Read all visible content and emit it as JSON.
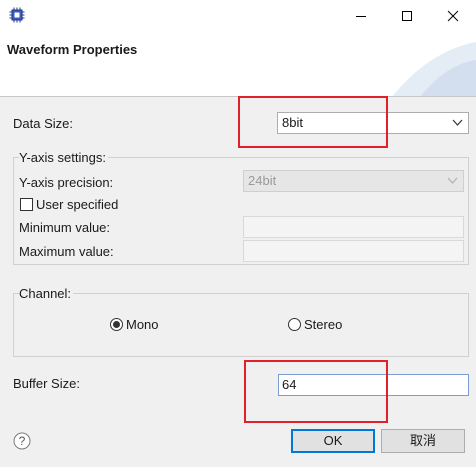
{
  "window": {
    "title": "Waveform Properties",
    "icon": "chip-icon",
    "controls": [
      "minimize-icon",
      "maximize-icon",
      "close-icon"
    ]
  },
  "form": {
    "data_size": {
      "label": "Data Size:",
      "value": "8bit"
    },
    "yaxis": {
      "group_label": "Y-axis settings:",
      "precision_label": "Y-axis precision:",
      "precision_value": "24bit",
      "user_specified_label": "User specified",
      "user_specified_checked": false,
      "min_label": "Minimum value:",
      "min_value": "",
      "max_label": "Maximum value:",
      "max_value": ""
    },
    "channel": {
      "group_label": "Channel:",
      "options": [
        {
          "label": "Mono",
          "selected": true
        },
        {
          "label": "Stereo",
          "selected": false
        }
      ]
    },
    "buffer_size": {
      "label": "Buffer Size:",
      "value": "64"
    }
  },
  "buttons": {
    "help_icon": "help-icon",
    "ok": "OK",
    "cancel": "取消"
  },
  "colors": {
    "highlight_box": "#e0202a",
    "accent": "#0078d7"
  }
}
